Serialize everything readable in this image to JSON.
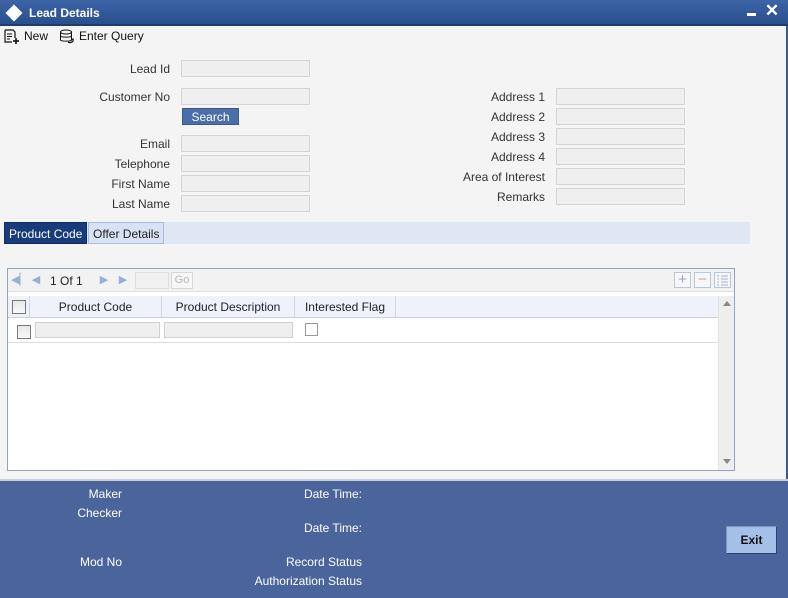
{
  "window": {
    "title": "Lead Details",
    "icons": {
      "app": "diamond-icon",
      "minimize": "minimize-icon",
      "close": "close-icon"
    },
    "close_glyph": "✕"
  },
  "toolbar": {
    "new_label": "New",
    "new_icon": "new-document-icon",
    "enter_query_label": "Enter Query",
    "enter_query_icon": "database-query-icon"
  },
  "form": {
    "left": {
      "lead_id": {
        "label": "Lead Id",
        "value": ""
      },
      "customer_no": {
        "label": "Customer No",
        "value": ""
      },
      "search_label": "Search",
      "email": {
        "label": "Email",
        "value": ""
      },
      "telephone": {
        "label": "Telephone",
        "value": ""
      },
      "first_name": {
        "label": "First Name",
        "value": ""
      },
      "last_name": {
        "label": "Last Name",
        "value": ""
      }
    },
    "right": {
      "address1": {
        "label": "Address 1",
        "value": ""
      },
      "address2": {
        "label": "Address 2",
        "value": ""
      },
      "address3": {
        "label": "Address 3",
        "value": ""
      },
      "address4": {
        "label": "Address 4",
        "value": ""
      },
      "area_of_interest": {
        "label": "Area of Interest",
        "value": ""
      },
      "remarks": {
        "label": "Remarks",
        "value": ""
      }
    }
  },
  "tabs": [
    {
      "label": "Product Code",
      "active": true
    },
    {
      "label": "Offer Details",
      "active": false
    }
  ],
  "grid": {
    "pagination": {
      "text": "1 Of 1",
      "current_page": 1,
      "total_pages": 1,
      "page_input": "",
      "go_label": "Go"
    },
    "nav_icons": [
      "first-page-icon",
      "prev-page-icon",
      "next-page-icon",
      "last-page-icon"
    ],
    "tools": {
      "add_glyph": "+",
      "delete_glyph": "−",
      "view_icon": "list-view-icon"
    },
    "columns": [
      "Product Code",
      "Product Description",
      "Interested Flag"
    ],
    "rows": [
      {
        "selected": false,
        "product_code": "",
        "product_description": "",
        "interested_flag": false
      }
    ]
  },
  "footer": {
    "maker": "Maker",
    "checker": "Checker",
    "date_time_1": "Date Time:",
    "date_time_2": "Date Time:",
    "mod_no": "Mod No",
    "record_status": "Record Status",
    "authorization_status": "Authorization Status",
    "exit_label": "Exit"
  },
  "colors": {
    "title_bar": "#2f5596",
    "footer": "#4a659c",
    "tab_active": "#183b7c",
    "search_button": "#4b6ea9",
    "exit_button": "#a5c0e6"
  }
}
